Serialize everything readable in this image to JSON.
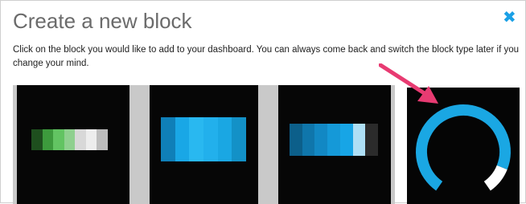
{
  "dialog": {
    "title": "Create a new block",
    "instructions": "Click on the block you would like to add to your dashboard. You can always come back and switch the block type later if you change your mind.",
    "close_icon": "close-icon"
  },
  "block_types": [
    {
      "id": "bar-green",
      "icon": "progress-bar-icon",
      "colors": [
        "#1e4f1e",
        "#3d9a3d",
        "#62c462",
        "#8fd08f",
        "#d8d8d8",
        "#ededed",
        "#bdbdbd"
      ]
    },
    {
      "id": "bar-blue",
      "icon": "progress-bar-icon",
      "colors": [
        "#0f7fb8",
        "#19a7e6",
        "#29b8f0",
        "#22b0ec",
        "#1aa7e3",
        "#1391c7"
      ]
    },
    {
      "id": "bar-blue-thin",
      "icon": "progress-bar-icon",
      "colors": [
        "#0c5f8a",
        "#0f76ab",
        "#1288c4",
        "#1599d8",
        "#17a5e6",
        "#aedff5",
        "#2b2b2b"
      ]
    },
    {
      "id": "gauge",
      "icon": "gauge-icon",
      "colors": [
        "#1aa7e3",
        "#ffffff"
      ]
    }
  ],
  "colors": {
    "accent": "#1aa0e6",
    "pointer_arrow": "#e83b72"
  }
}
